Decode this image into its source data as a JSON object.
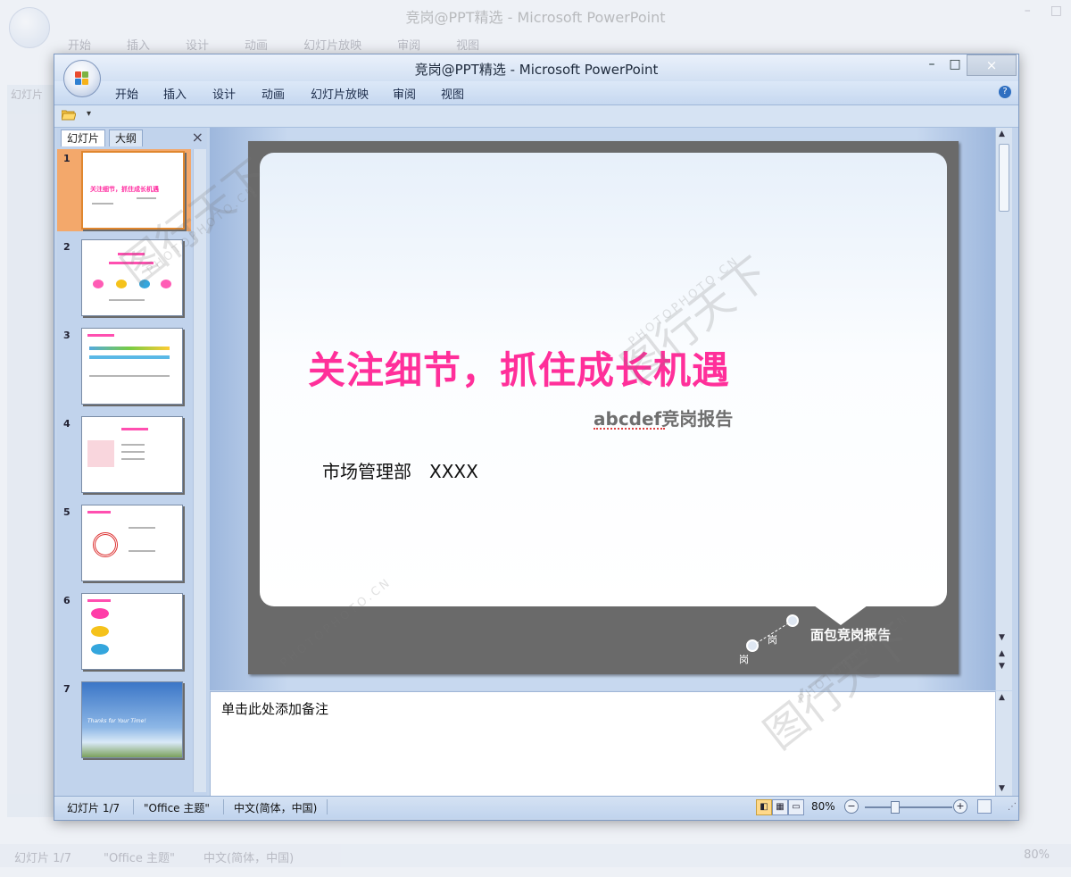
{
  "app": {
    "title": "竞岗@PPT精选  - Microsoft PowerPoint",
    "window_controls": {
      "minimize": "–",
      "maximize": "□",
      "close": "×"
    }
  },
  "ribbon": {
    "tabs": [
      "开始",
      "插入",
      "设计",
      "动画",
      "幻灯片放映",
      "审阅",
      "视图"
    ],
    "help": "?"
  },
  "qat": {
    "open_icon": "folder-open-icon",
    "dropdown": "▾"
  },
  "slides_pane": {
    "tabs": [
      "幻灯片",
      "大纲"
    ],
    "close": "×",
    "thumbnails": [
      {
        "number": "1",
        "title": "关注细节，抓住成长机遇",
        "selected": true
      },
      {
        "number": "2",
        "title": ""
      },
      {
        "number": "3",
        "title": ""
      },
      {
        "number": "4",
        "title": ""
      },
      {
        "number": "5",
        "title": ""
      },
      {
        "number": "6",
        "title": ""
      },
      {
        "number": "7",
        "title": "Thanks for Your Time!"
      }
    ]
  },
  "slide": {
    "title": "关注细节，抓住成长机遇",
    "subtitle": "abcdef竞岗报告",
    "department": "市场管理部　XXXX",
    "footer": "面包竞岗报告",
    "footer_labels": [
      "岗",
      "岗"
    ],
    "colors": {
      "title": "#ff2f9a",
      "background": "#6a6a6a"
    }
  },
  "notes": {
    "placeholder": "单击此处添加备注"
  },
  "status_bar": {
    "slide_counter": "幻灯片 1/7",
    "theme": "\"Office 主题\"",
    "language": "中文(简体，中国)",
    "zoom": "80%",
    "zoom_minus": "−",
    "zoom_plus": "+"
  },
  "watermark": {
    "logo_text": "图行天下",
    "site_text": "PHOTOPHOTO.CN"
  },
  "background_window": {
    "title": "竞岗@PPT精选  - Microsoft PowerPoint",
    "tabs": [
      "开始",
      "插入",
      "设计",
      "动画",
      "幻灯片放映",
      "审阅",
      "视图"
    ],
    "left_tab": "幻灯片",
    "status": {
      "slide_counter": "幻灯片 1/7",
      "theme": "\"Office 主题\"",
      "language": "中文(简体，中国)",
      "zoom": "80%"
    }
  }
}
